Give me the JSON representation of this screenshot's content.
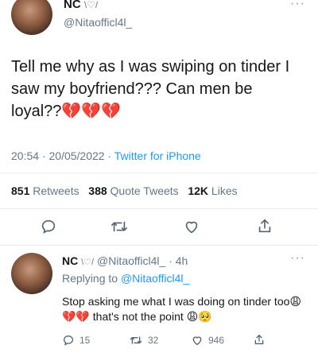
{
  "tweet": {
    "display_name": "NC",
    "name_decoration": "\\♡/",
    "handle": "@Nitaofficl4l_",
    "text": "Tell me why as I was swiping on tinder I saw my boyfriend??? Can men be loyal??",
    "text_emojis": "💔💔💔",
    "time": "20:54",
    "date": "20/05/2022",
    "separator": "·",
    "source": "Twitter for iPhone",
    "stats": {
      "retweets_count": "851",
      "retweets_label": "Retweets",
      "quotes_count": "388",
      "quotes_label": "Quote Tweets",
      "likes_count": "12K",
      "likes_label": "Likes"
    },
    "more": "···"
  },
  "actions": [
    "reply-icon",
    "retweet-icon",
    "like-icon",
    "share-icon"
  ],
  "reply": {
    "display_name": "NC",
    "name_decoration": "\\♡/",
    "handle": "@Nitaofficl4l_",
    "age": "· 4h",
    "replying_prefix": "Replying to",
    "replying_handle": "@Nitaofficl4l_",
    "text_part1": "Stop asking me what I was doing on tinder too",
    "text_emojis1": "😩💔💔",
    "text_part2": "that's not the point",
    "text_emojis2": "😩🥺",
    "reply_count": "15",
    "retweet_count": "32",
    "like_count": "946",
    "more": "···"
  },
  "colors": {
    "link": "#1d9bf0",
    "muted": "#657786",
    "heartbreak": "#d4193a"
  }
}
